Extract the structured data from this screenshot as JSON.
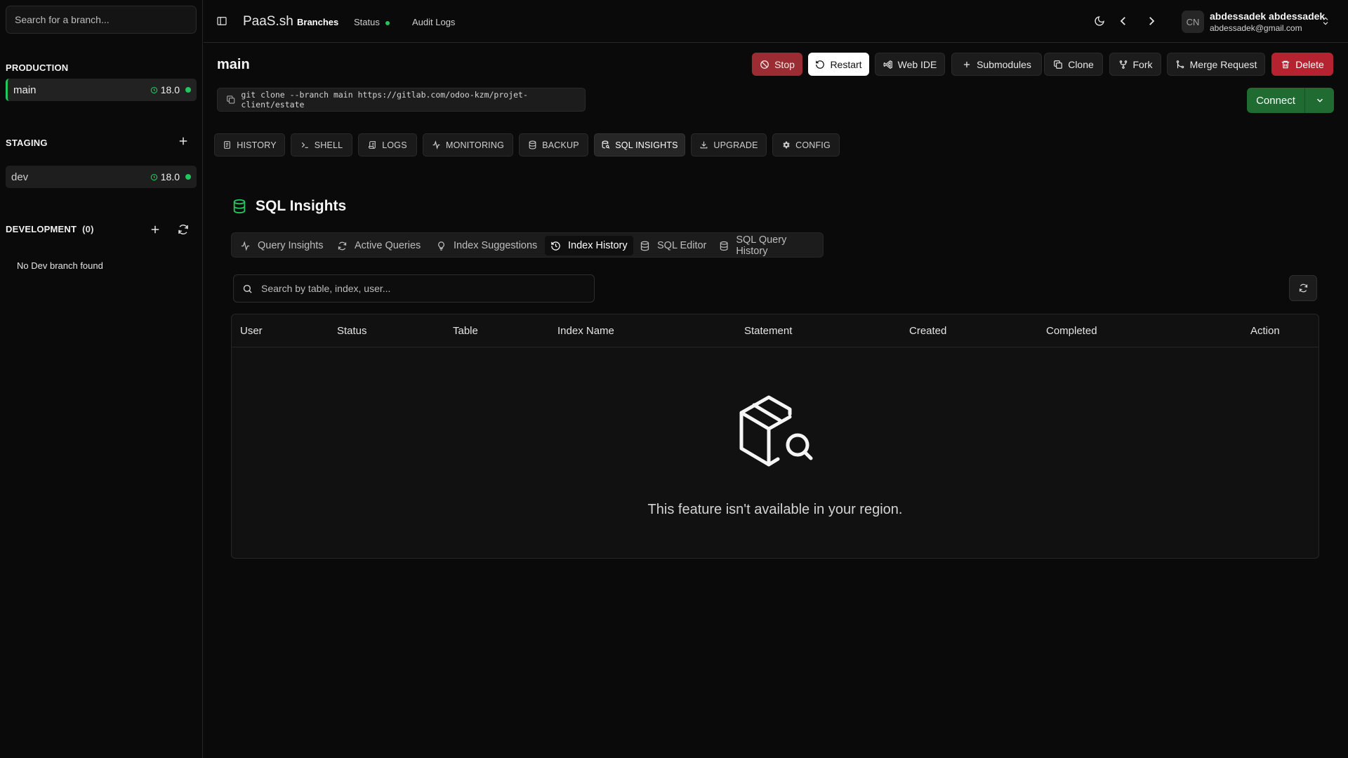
{
  "sidebar": {
    "search_placeholder": "Search for a branch...",
    "production": {
      "title": "PRODUCTION",
      "branches": [
        {
          "name": "main",
          "version": "18.0"
        }
      ]
    },
    "staging": {
      "title": "STAGING",
      "branches": [
        {
          "name": "dev",
          "version": "18.0"
        }
      ]
    },
    "development": {
      "title": "DEVELOPMENT",
      "count": "(0)",
      "empty": "No Dev branch found"
    }
  },
  "topbar": {
    "brand": "PaaS.sh",
    "nav": {
      "branches": "Branches",
      "status": "Status",
      "audit_logs": "Audit Logs"
    },
    "user": {
      "initials": "CN",
      "name": "abdessadek abdessadek",
      "email": "abdessadek@gmail.com"
    }
  },
  "branch": {
    "title": "main",
    "actions": {
      "stop": "Stop",
      "restart": "Restart",
      "web_ide": "Web IDE",
      "submodules": "Submodules",
      "clone": "Clone",
      "fork": "Fork",
      "merge_request": "Merge Request",
      "delete": "Delete"
    },
    "clone_command": "git clone --branch main https://gitlab.com/odoo-kzm/projet-client/estate",
    "connect": "Connect"
  },
  "tabs": {
    "history": "HISTORY",
    "shell": "SHELL",
    "logs": "LOGS",
    "monitoring": "MONITORING",
    "backup": "BACKUP",
    "sql_insights": "SQL INSIGHTS",
    "upgrade": "UPGRADE",
    "config": "CONFIG"
  },
  "sql": {
    "title": "SQL Insights",
    "subtabs": {
      "query_insights": "Query Insights",
      "active_queries": "Active Queries",
      "index_suggestions": "Index Suggestions",
      "index_history": "Index History",
      "sql_editor": "SQL Editor",
      "sql_query_history": "SQL Query History"
    },
    "search_placeholder": "Search by table, index, user...",
    "columns": {
      "user": "User",
      "status": "Status",
      "table": "Table",
      "index_name": "Index Name",
      "statement": "Statement",
      "created": "Created",
      "completed": "Completed",
      "action": "Action"
    },
    "empty_message": "This feature isn't available in your region."
  },
  "colors": {
    "accent_green": "#22c55e",
    "stop_red": "#9b2c33",
    "delete_red": "#b4232f",
    "connect_green": "#1f6b32"
  }
}
